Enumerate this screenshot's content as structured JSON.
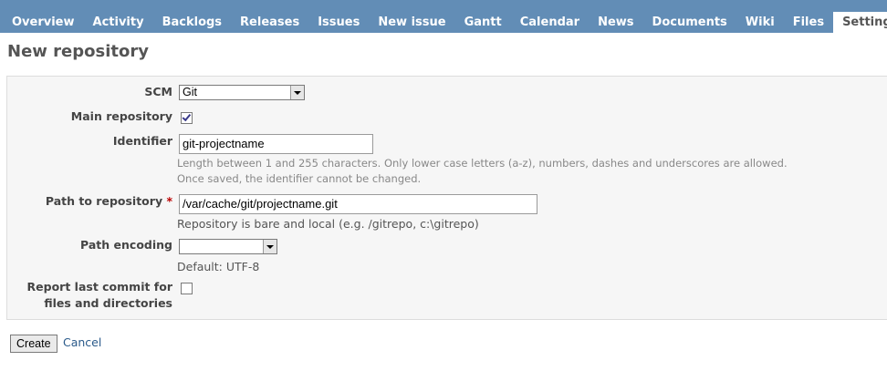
{
  "tabs": [
    {
      "label": "Overview",
      "selected": false
    },
    {
      "label": "Activity",
      "selected": false
    },
    {
      "label": "Backlogs",
      "selected": false
    },
    {
      "label": "Releases",
      "selected": false
    },
    {
      "label": "Issues",
      "selected": false
    },
    {
      "label": "New issue",
      "selected": false
    },
    {
      "label": "Gantt",
      "selected": false
    },
    {
      "label": "Calendar",
      "selected": false
    },
    {
      "label": "News",
      "selected": false
    },
    {
      "label": "Documents",
      "selected": false
    },
    {
      "label": "Wiki",
      "selected": false
    },
    {
      "label": "Files",
      "selected": false
    },
    {
      "label": "Settings",
      "selected": true
    }
  ],
  "page": {
    "title": "New repository"
  },
  "form": {
    "scm": {
      "label": "SCM",
      "value": "Git"
    },
    "main_repository": {
      "label": "Main repository",
      "checked": true
    },
    "identifier": {
      "label": "Identifier",
      "value": "git-projectname",
      "hint1": "Length between 1 and 255 characters. Only lower case letters (a-z), numbers, dashes and underscores are allowed.",
      "hint2": "Once saved, the identifier cannot be changed."
    },
    "path": {
      "label": "Path to repository",
      "required_mark": "*",
      "value": "/var/cache/git/projectname.git",
      "note": "Repository is bare and local (e.g. /gitrepo, c:\\gitrepo)"
    },
    "path_encoding": {
      "label": "Path encoding",
      "value": "",
      "note": "Default: UTF-8"
    },
    "report_last_commit": {
      "label_line1": "Report last commit for",
      "label_line2": "files and directories",
      "checked": false
    }
  },
  "actions": {
    "create_label": "Create",
    "cancel_label": "Cancel"
  },
  "colors": {
    "tab_bar": "#628db6",
    "required": "#bb0000",
    "link": "#2a5a8a"
  }
}
